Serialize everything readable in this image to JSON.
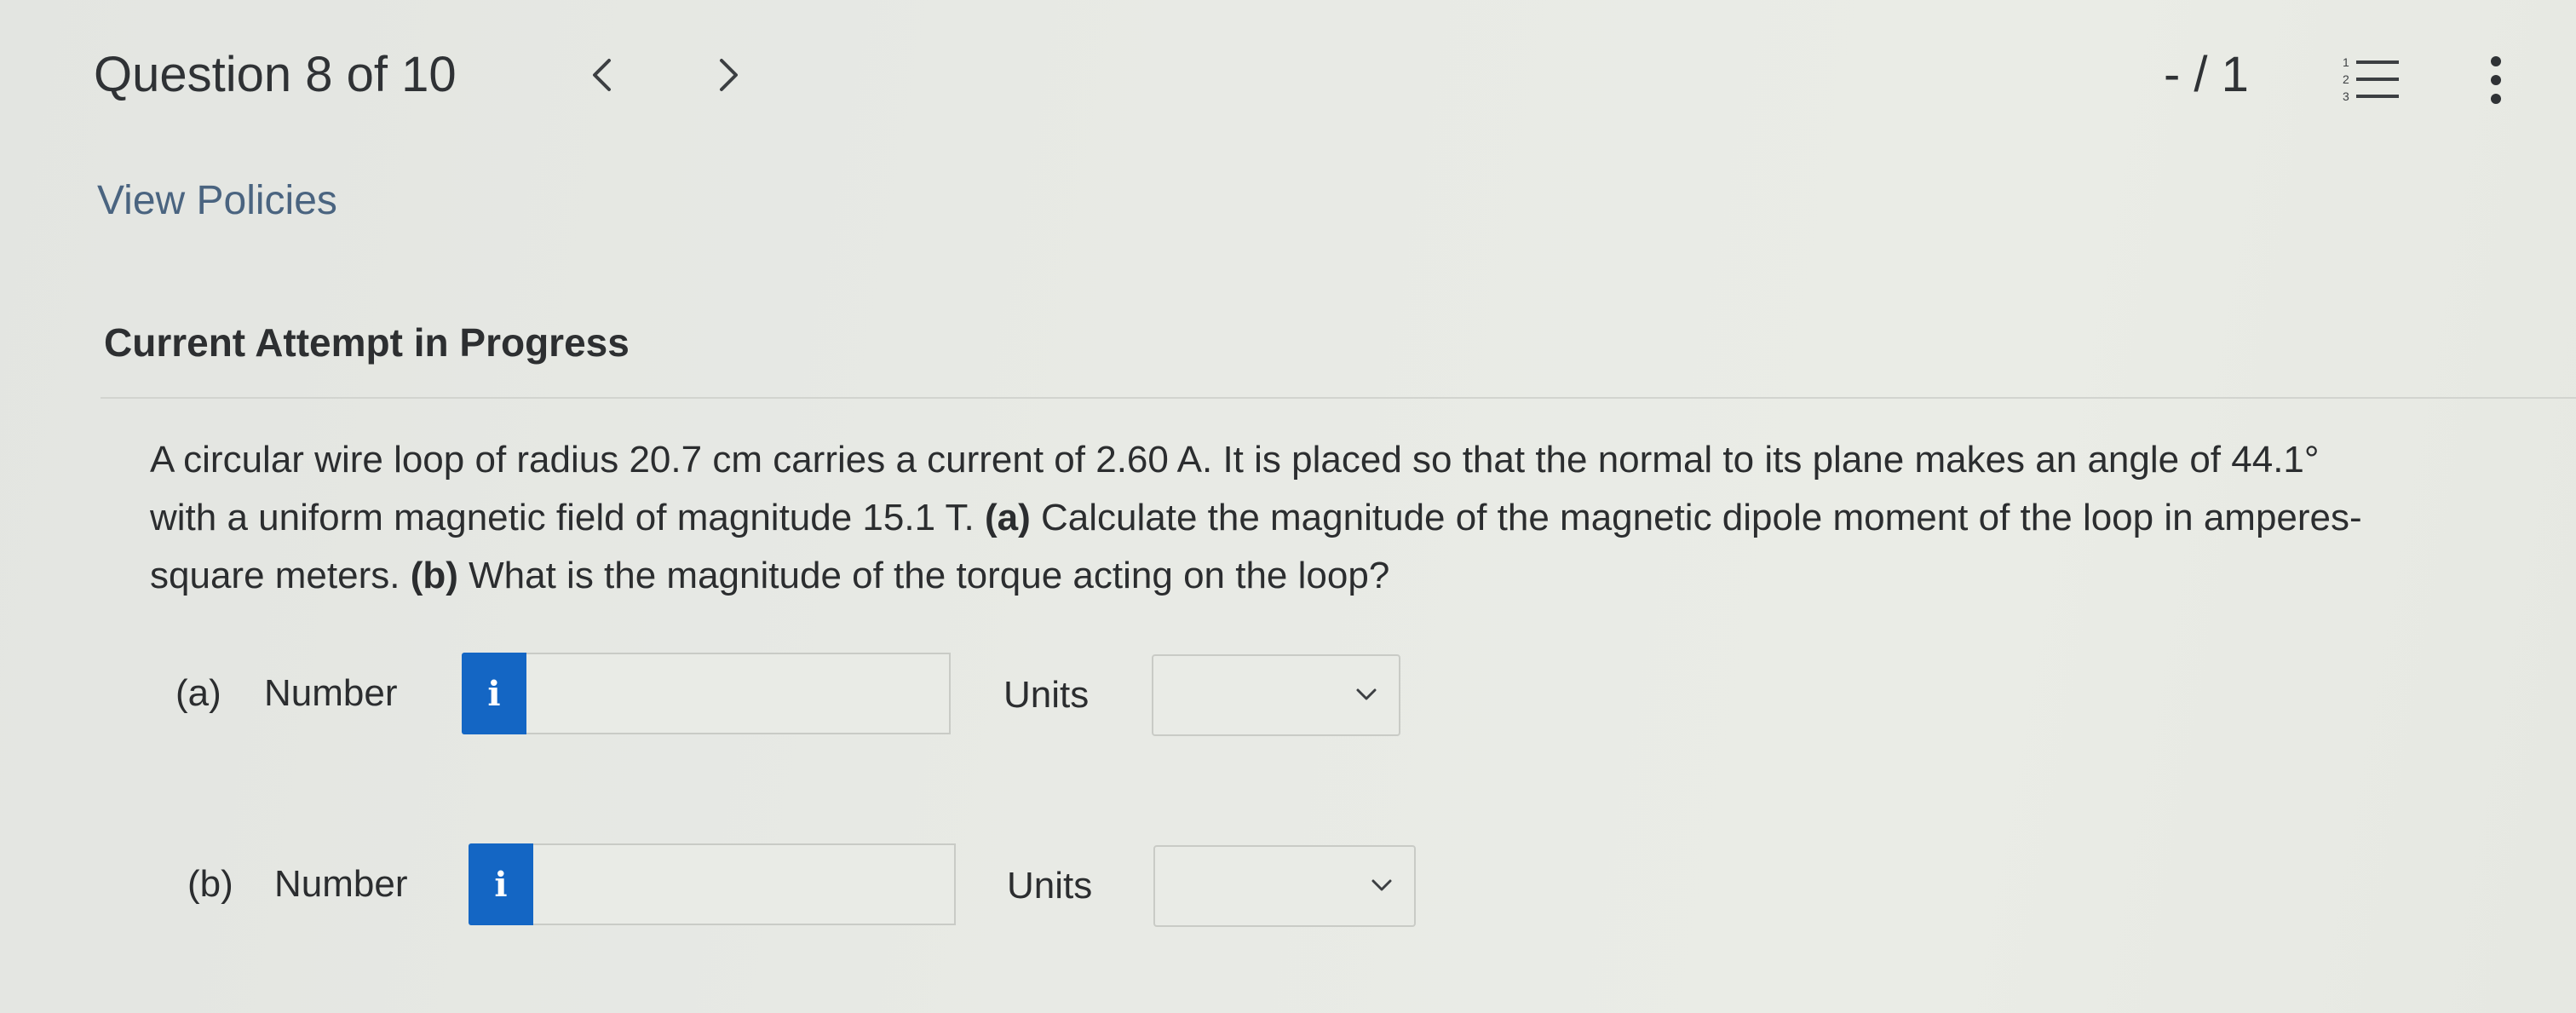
{
  "header": {
    "title": "Question 8 of 10",
    "prev_icon": "chevron-left-icon",
    "next_icon": "chevron-right-icon",
    "score": "- / 1",
    "list_icon": "numbered-list-icon",
    "more_icon": "vertical-ellipsis-icon"
  },
  "links": {
    "view_policies": "View Policies"
  },
  "attempt": {
    "status": "Current Attempt in Progress"
  },
  "question": {
    "lines": [
      "A circular wire loop of radius 20.7 cm carries a current of 2.60 A. It is placed so that the normal to its plane makes an angle of 44.1°",
      "with a uniform magnetic field of magnitude 15.1 T.",
      "(a)",
      "Calculate the magnitude of the magnetic dipole moment of the loop in amperes-",
      "square meters.",
      "(b)",
      "What is the magnitude of the torque acting on the loop?"
    ]
  },
  "answers": [
    {
      "part": "(a)",
      "number_label": "Number",
      "info_icon": "info-icon",
      "number_value": "",
      "units_label": "Units",
      "units_value": ""
    },
    {
      "part": "(b)",
      "number_label": "Number",
      "info_icon": "info-icon",
      "number_value": "",
      "units_label": "Units",
      "units_value": ""
    }
  ],
  "colors": {
    "accent": "#1466c4",
    "link": "#4a6480",
    "background": "#e7e9e4"
  }
}
